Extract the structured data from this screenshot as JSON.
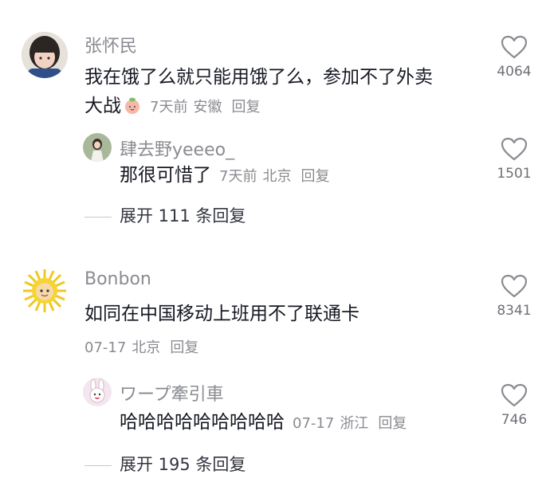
{
  "comments": [
    {
      "user": "张怀民",
      "text_line1": "我在饿了么就只能用饿了么，参加不了外卖",
      "text_line2": "大战",
      "time": "7天前",
      "location": "安徽",
      "reply_label": "回复",
      "likes": "4064"
    },
    {
      "user": "Bonbon",
      "text": "如同在中国移动上班用不了联通卡",
      "time": "07-17",
      "location": "北京",
      "reply_label": "回复",
      "likes": "8341"
    }
  ],
  "replies": [
    {
      "user": "肆去野yeeeo_",
      "text": "那很可惜了",
      "time": "7天前",
      "location": "北京",
      "reply_label": "回复",
      "likes": "1501"
    },
    {
      "user": "ワープ牽引車",
      "text": "哈哈哈哈哈哈哈哈哈",
      "time": "07-17",
      "location": "浙江",
      "reply_label": "回复",
      "likes": "746"
    }
  ],
  "expand": [
    {
      "label": "展开 111 条回复"
    },
    {
      "label": "展开 195 条回复"
    }
  ],
  "colors": {
    "text": "#161823",
    "muted": "#8a8b91",
    "background": "#ffffff"
  }
}
